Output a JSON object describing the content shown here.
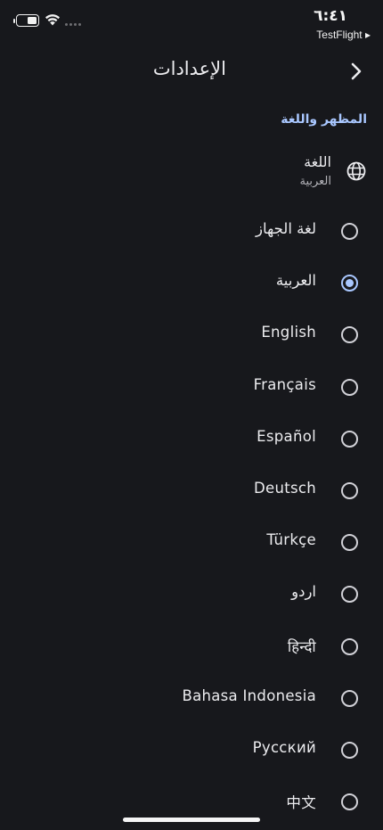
{
  "status_bar": {
    "time": "٦:٤١",
    "back_to_app": "TestFlight ▸"
  },
  "header": {
    "title": "الإعدادات",
    "back_icon": "chevron-right-icon"
  },
  "section": {
    "title": "المظهر واللغة"
  },
  "language": {
    "title": "اللغة",
    "current": "العربية",
    "icon": "globe-icon"
  },
  "options": [
    {
      "label": "لغة الجهاز",
      "selected": false
    },
    {
      "label": "العربية",
      "selected": true
    },
    {
      "label": "English",
      "selected": false
    },
    {
      "label": "Français",
      "selected": false
    },
    {
      "label": "Español",
      "selected": false
    },
    {
      "label": "Deutsch",
      "selected": false
    },
    {
      "label": "Türkçe",
      "selected": false
    },
    {
      "label": "اردو",
      "selected": false
    },
    {
      "label": "हिन्दी",
      "selected": false
    },
    {
      "label": "Bahasa Indonesia",
      "selected": false
    },
    {
      "label": "Русский",
      "selected": false
    },
    {
      "label": "中文",
      "selected": false
    }
  ],
  "colors": {
    "background": "#17181c",
    "accent": "#a9c7ff",
    "text": "#ececef"
  }
}
